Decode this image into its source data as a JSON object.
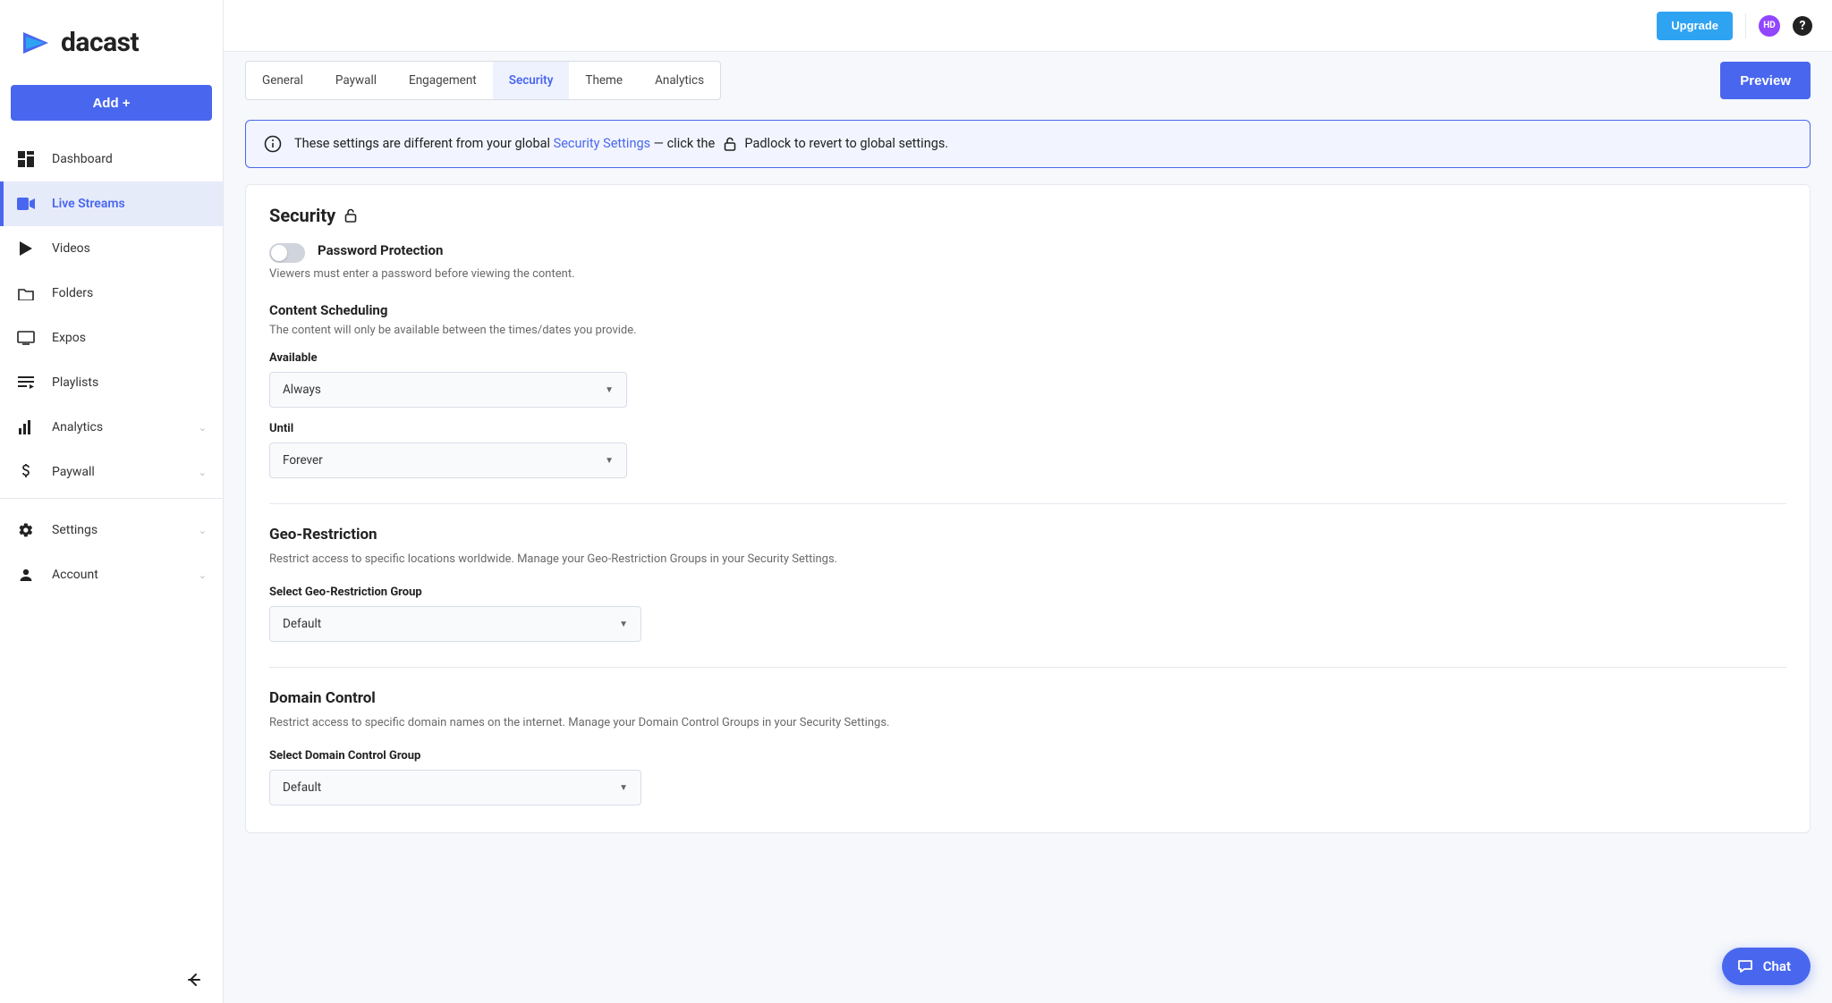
{
  "brand": {
    "name": "dacast"
  },
  "sidebar": {
    "add_button": "Add +",
    "items": [
      {
        "label": "Dashboard"
      },
      {
        "label": "Live Streams"
      },
      {
        "label": "Videos"
      },
      {
        "label": "Folders"
      },
      {
        "label": "Expos"
      },
      {
        "label": "Playlists"
      },
      {
        "label": "Analytics"
      },
      {
        "label": "Paywall"
      },
      {
        "label": "Settings"
      },
      {
        "label": "Account"
      }
    ]
  },
  "topbar": {
    "upgrade": "Upgrade",
    "avatar_initials": "HD"
  },
  "tabs": {
    "items": [
      {
        "label": "General"
      },
      {
        "label": "Paywall"
      },
      {
        "label": "Engagement"
      },
      {
        "label": "Security"
      },
      {
        "label": "Theme"
      },
      {
        "label": "Analytics"
      }
    ],
    "preview": "Preview"
  },
  "banner": {
    "prefix": "These settings are different from your global ",
    "link": "Security Settings",
    "middle": " — click the ",
    "suffix": " Padlock to revert to global settings."
  },
  "security": {
    "title": "Security",
    "password": {
      "title": "Password Protection",
      "desc": "Viewers must enter a password before viewing the content."
    },
    "scheduling": {
      "title": "Content Scheduling",
      "desc": "The content will only be available between the times/dates you provide.",
      "available_label": "Available",
      "available_value": "Always",
      "until_label": "Until",
      "until_value": "Forever"
    },
    "geo": {
      "title": "Geo-Restriction",
      "desc": "Restrict access to specific locations worldwide. Manage your Geo-Restriction Groups in your Security Settings.",
      "label": "Select Geo-Restriction Group",
      "value": "Default"
    },
    "domain": {
      "title": "Domain Control",
      "desc": "Restrict access to specific domain names on the internet. Manage your Domain Control Groups in your Security Settings.",
      "label": "Select Domain Control Group",
      "value": "Default"
    }
  },
  "chat": {
    "label": "Chat"
  }
}
